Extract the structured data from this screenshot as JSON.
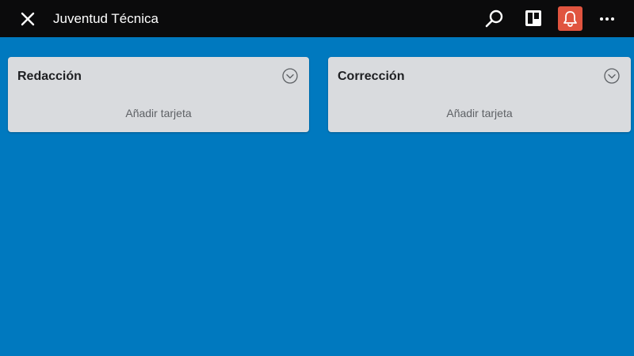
{
  "header": {
    "title": "Juventud Técnica",
    "icons": {
      "close": "close-icon",
      "search": "search-icon",
      "board_view": "board-view-icon",
      "notifications": "bell-icon",
      "more": "more-icon"
    },
    "notification_color": "#e0543f",
    "bar_color": "#0b0b0c"
  },
  "board": {
    "background_color": "#0079bf",
    "lists": [
      {
        "title": "Redacción",
        "add_card_label": "Añadir tarjeta"
      },
      {
        "title": "Corrección",
        "add_card_label": "Añadir tarjeta"
      }
    ]
  }
}
